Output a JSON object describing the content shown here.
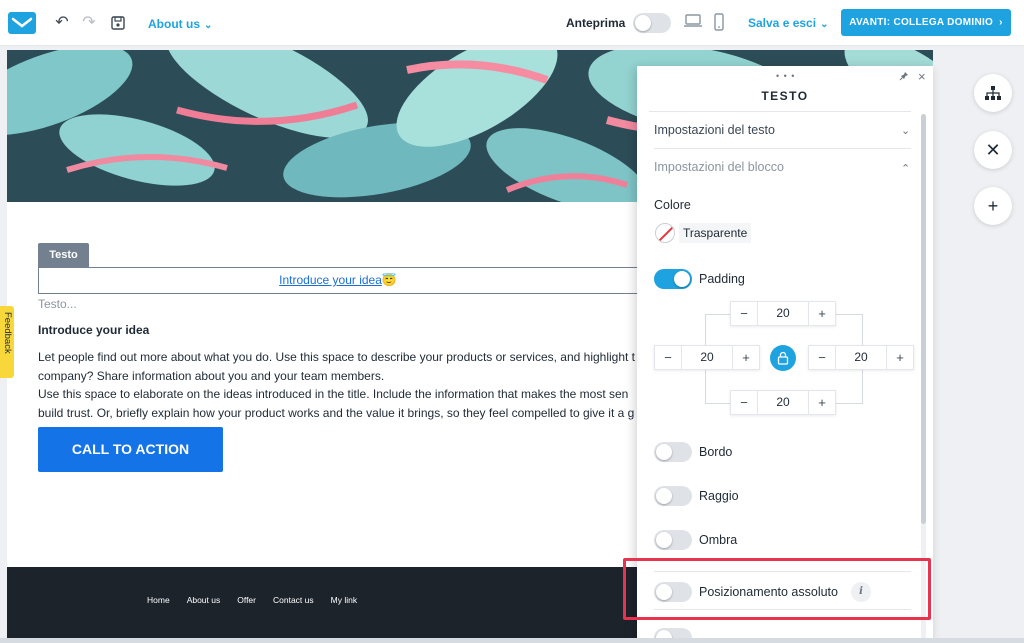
{
  "topbar": {
    "page_select": "About us",
    "preview_label": "Anteprima",
    "save_exit": "Salva e esci",
    "next_button": "AVANTI: COLLEGA DOMINIO"
  },
  "editor": {
    "text_tag": "Testo",
    "intro_link": "Introduce your idea",
    "intro_emoji": "😇",
    "placeholder": "Testo...",
    "intro_title": "Introduce your idea",
    "body_lines": [
      "Let people find out more about what you do. Use this space to describe your products or services, and highlight t",
      "company? Share information about you and your team members.",
      "Use this space to elaborate on the ideas introduced in the title. Include the information that makes the most sen",
      "build trust. Or, briefly explain how your product works and the value it brings, so they feel compelled to give it a g"
    ],
    "cta": "CALL TO ACTION",
    "footer_nav": [
      "Home",
      "About us",
      "Offer",
      "Contact us",
      "My link"
    ],
    "feedback": "Feedback"
  },
  "panel": {
    "dots": "• • •",
    "title": "TESTO",
    "text_settings": "Impostazioni del testo",
    "block_settings": "Impostazioni del blocco",
    "color_label": "Colore",
    "color_value": "Trasparente",
    "padding_label": "Padding",
    "padding": {
      "top": "20",
      "left": "20",
      "right": "20",
      "bottom": "20"
    },
    "border_label": "Bordo",
    "radius_label": "Raggio",
    "shadow_label": "Ombra",
    "absolute_label": "Posizionamento assoluto",
    "info": "i"
  },
  "toggles": {
    "preview": false,
    "padding": true,
    "border": false,
    "radius": false,
    "shadow": false,
    "absolute": false
  },
  "colors": {
    "accent": "#1fa3e0",
    "cta": "#1473e6",
    "footer": "#1d232b",
    "highlight": "#e8334f"
  }
}
